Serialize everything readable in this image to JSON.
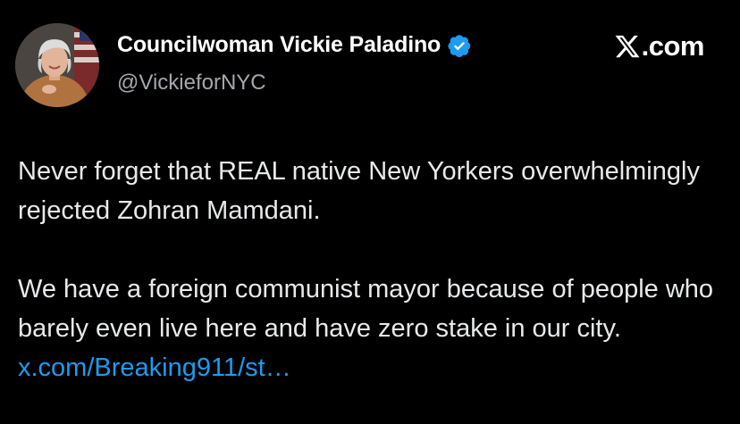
{
  "author": {
    "display_name": "Councilwoman Vickie Paladino",
    "handle": "@VickieforNYC",
    "verified": true,
    "avatar_icon": "profile-photo"
  },
  "brand": {
    "logo_icon": "x-logo-icon",
    "suffix": ".com"
  },
  "tweet": {
    "paragraph1": "Never forget that REAL native New Yorkers overwhelmingly rejected Zohran Mamdani.",
    "paragraph2_text": "We have a foreign communist mayor because of people who barely even live here and have zero stake in our city. ",
    "link_text": "x.com/Breaking911/st…"
  },
  "colors": {
    "background": "#000000",
    "text": "#e7e9ea",
    "secondary": "#a3a8ad",
    "link": "#1d9bf0",
    "verified_badge": "#1d9bf0"
  }
}
